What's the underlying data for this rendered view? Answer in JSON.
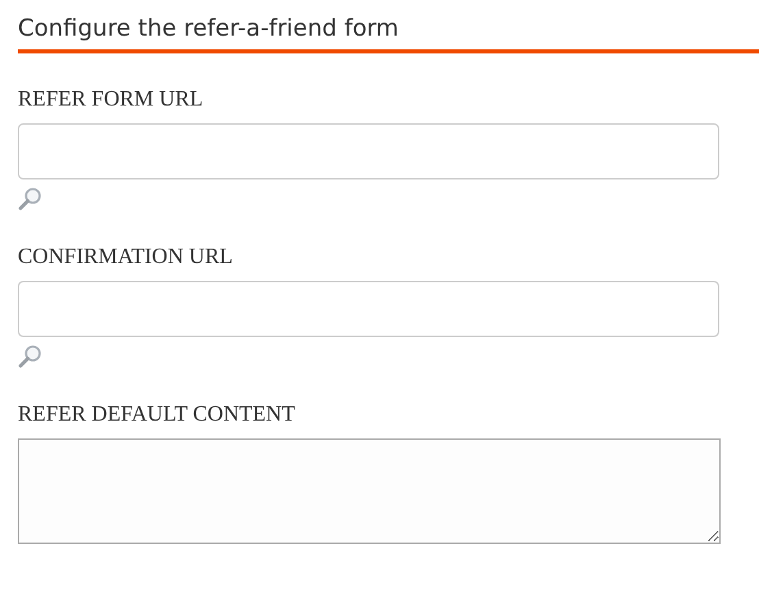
{
  "section": {
    "title": "Configure the refer-a-friend form"
  },
  "fields": [
    {
      "label": "REFER FORM URL",
      "kind": "url"
    },
    {
      "label": "CONFIRMATION URL",
      "kind": "url"
    },
    {
      "label": "REFER DEFAULT CONTENT",
      "kind": "textarea"
    }
  ]
}
